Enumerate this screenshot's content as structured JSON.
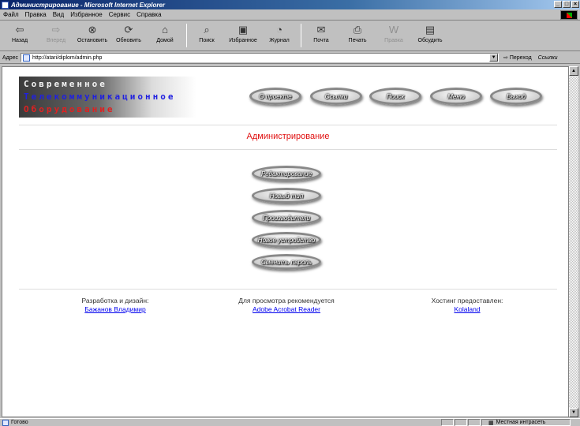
{
  "window": {
    "title": "Администрирование - Microsoft Internet Explorer"
  },
  "menu": [
    "Файл",
    "Правка",
    "Вид",
    "Избранное",
    "Сервис",
    "Справка"
  ],
  "toolbar": {
    "back": "Назад",
    "forward": "Вперед",
    "stop": "Остановить",
    "refresh": "Обновить",
    "home": "Домой",
    "search": "Поиск",
    "favorites": "Избранное",
    "history": "Журнал",
    "mail": "Почта",
    "print": "Печать",
    "edit": "Правка",
    "discuss": "Обсудить"
  },
  "address": {
    "label": "Адрес",
    "url": "http://atari/diplom/admin.php",
    "go": "Переход",
    "links": "Ссылки"
  },
  "logo": {
    "line1": "Современное",
    "line2": "Телекоммуникационное",
    "line3": "Оборудование"
  },
  "nav": [
    "О проекте",
    "Ссылки",
    "Поиск",
    "Меню",
    "Выход"
  ],
  "page_title": "Администрирование",
  "admin_menu": [
    "Редактирование",
    "Новый тип",
    "Производители",
    "Новое устройство",
    "Сменить пароль"
  ],
  "footer": {
    "dev_label": "Разработка и дизайн:",
    "dev_name": "Бажанов Владимир",
    "view_label": "Для просмотра рекомендуется",
    "view_app": "Adobe Acrobat Reader",
    "host_label": "Хостинг предоставлен:",
    "host_name": "Kolaland"
  },
  "status": {
    "left": "Готово",
    "zone": "Местная интрасеть"
  },
  "colors": {
    "title_accent": "#e01010",
    "link": "#0000ee",
    "logo_blue": "#2020e0",
    "logo_red": "#e02020"
  }
}
